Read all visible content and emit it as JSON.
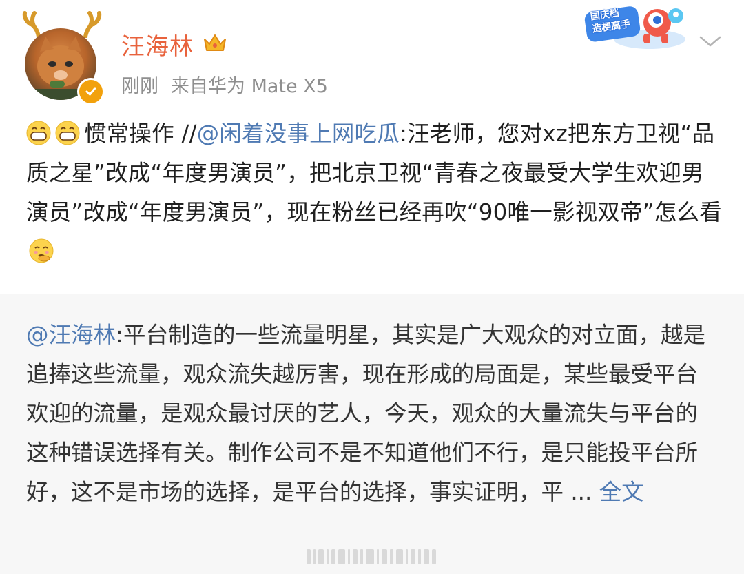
{
  "post": {
    "author": {
      "name": "汪海林",
      "avatar": "avatar",
      "crown_icon": "crown-icon",
      "verified_icon": "verified-badge-icon"
    },
    "time": "刚刚",
    "source": "来自华为 Mate X5",
    "badge_lines": [
      "国庆档",
      "造梗高手"
    ],
    "content": {
      "prefix": "惯常操作 //",
      "mention": "@闲着没事上网吃瓜",
      "body": ":汪老师，您对xz把东方卫视“品质之星”改成“年度男演员”，把北京卫视“青春之夜最受大学生欢迎男演员”改成“年度男演员”，现在粉丝已经再吹“90唯一影视双帝”怎么看"
    }
  },
  "retweet": {
    "mention": "@汪海林",
    "body": ":平台制造的一些流量明星，其实是广大观众的对立面，越是追捧这些流量，观众流失越厉害，现在形成的局面是，某些最受平台欢迎的流量，是观众最讨厌的艺人，今天，观众的大量流失与平台的这种错误选择有关。制作公司不是不知道他们不行，是只能投平台所好，这不是市场的选择，是平台的选择，事实证明，平 ...",
    "full_text_link": "全文"
  },
  "colors": {
    "username": "#e8623c",
    "link": "#4f7ab3",
    "meta": "#8f8f8f",
    "retweet_bg": "#f7f7f7"
  }
}
